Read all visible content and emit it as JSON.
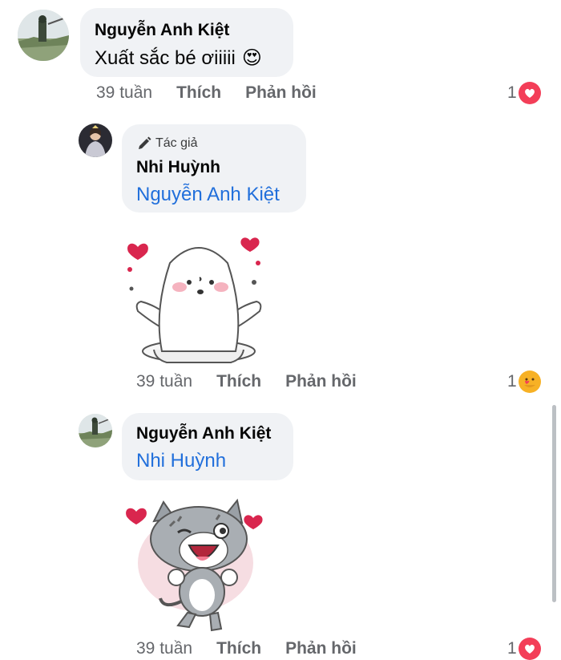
{
  "comments": [
    {
      "name": "Nguyễn Anh Kiệt",
      "text": "Xuất sắc bé ơiiiii",
      "emoji": "😍",
      "time": "39 tuần",
      "like": "Thích",
      "reply": "Phản hồi",
      "reaction_count": "1",
      "reaction": "love-icon"
    },
    {
      "badge": "Tác giả",
      "name": "Nhi Huỳnh",
      "tag": "Nguyễn Anh Kiệt",
      "time": "39 tuần",
      "like": "Thích",
      "reply": "Phản hồi",
      "reaction_count": "1",
      "reaction": "care-icon"
    },
    {
      "name": "Nguyễn Anh Kiệt",
      "tag": "Nhi Huỳnh",
      "time": "39 tuần",
      "like": "Thích",
      "reply": "Phản hồi",
      "reaction_count": "1",
      "reaction": "love-icon"
    }
  ],
  "colors": {
    "bubble": "#f0f2f5",
    "tag_link": "#216fdb",
    "meta": "#65676b",
    "love": "#f33e58",
    "care": "#f7b125"
  }
}
